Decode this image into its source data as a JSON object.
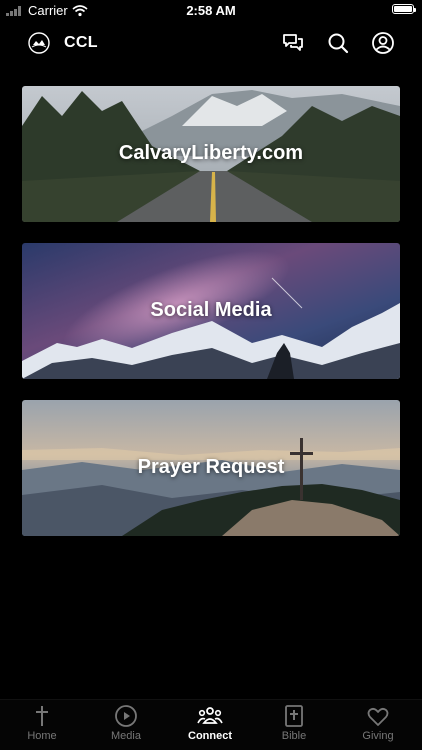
{
  "status_bar": {
    "carrier": "Carrier",
    "time": "2:58 AM"
  },
  "header": {
    "title": "CCL",
    "icons": [
      "logo-icon",
      "chat-icon",
      "search-icon",
      "profile-icon"
    ]
  },
  "cards": [
    {
      "label": "CalvaryLiberty.com",
      "image": "road-mountains"
    },
    {
      "label": "Social Media",
      "image": "milky-way-mountains"
    },
    {
      "label": "Prayer Request",
      "image": "cross-on-hill"
    }
  ],
  "tabs": [
    {
      "label": "Home",
      "icon": "cross-icon"
    },
    {
      "label": "Media",
      "icon": "play-circle-icon"
    },
    {
      "label": "Connect",
      "icon": "people-icon",
      "active": true
    },
    {
      "label": "Bible",
      "icon": "bible-icon"
    },
    {
      "label": "Giving",
      "icon": "heart-icon"
    }
  ]
}
